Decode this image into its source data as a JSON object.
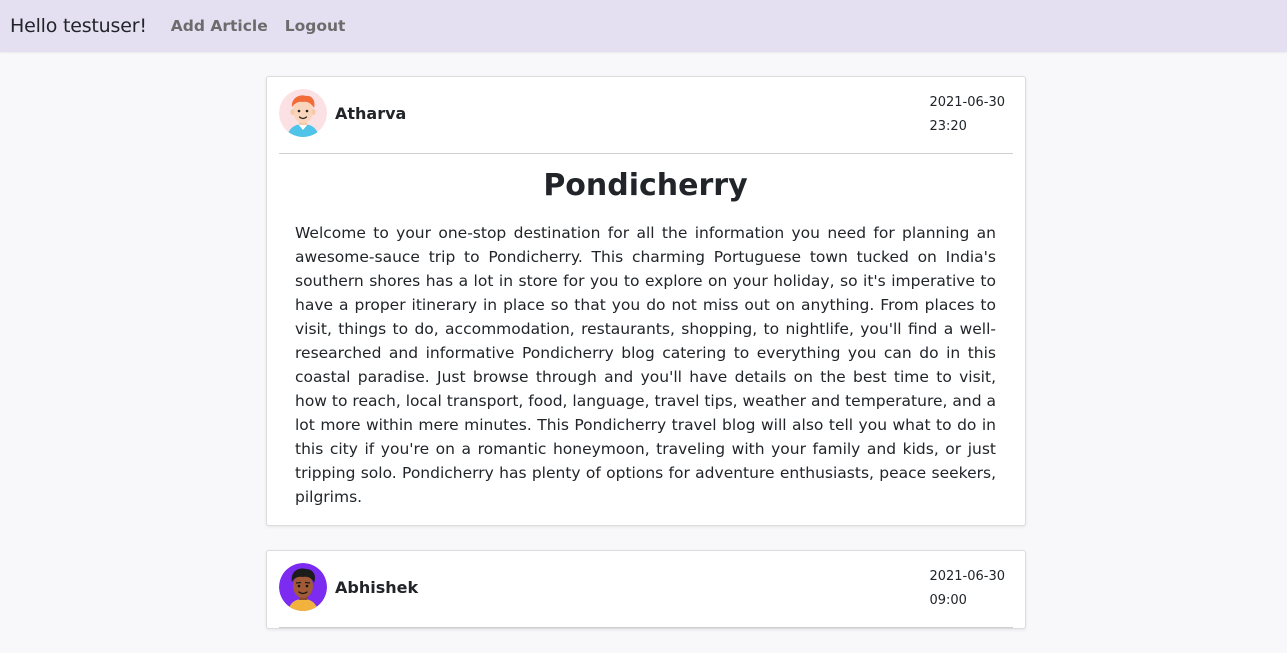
{
  "navbar": {
    "greeting": "Hello testuser!",
    "links": [
      "Add Article",
      "Logout"
    ]
  },
  "colors": {
    "navbar_bg": "#e5dff2",
    "page_bg": "#f8f8fa",
    "avatar1_bg": "#fce1e4",
    "avatar2_bg": "#7b2cf0"
  },
  "articles": [
    {
      "author": "Atharva",
      "avatar_icon": "avatar-redhead-boy-icon",
      "date": "2021-06-30",
      "time": "23:20",
      "title": "Pondicherry",
      "content": "Welcome to your one-stop destination for all the information you need for planning an awesome-sauce trip to Pondicherry. This charming Portuguese town tucked on India's southern shores has a lot in store for you to explore on your holiday, so it's imperative to have a proper itinerary in place so that you do not miss out on anything. From places to visit, things to do, accommodation, restaurants, shopping, to nightlife, you'll find a well-researched and informative Pondicherry blog catering to everything you can do in this coastal paradise. Just browse through and you'll have details on the best time to visit, how to reach, local transport, food, language, travel tips, weather and temperature, and a lot more within mere minutes. This Pondicherry travel blog will also tell you what to do in this city if you're on a romantic honeymoon, traveling with your family and kids, or just tripping solo. Pondicherry has plenty of options for adventure enthusiasts, peace seekers, pilgrims."
    },
    {
      "author": "Abhishek",
      "avatar_icon": "avatar-dark-hair-man-icon",
      "date": "2021-06-30",
      "time": "09:00"
    }
  ]
}
